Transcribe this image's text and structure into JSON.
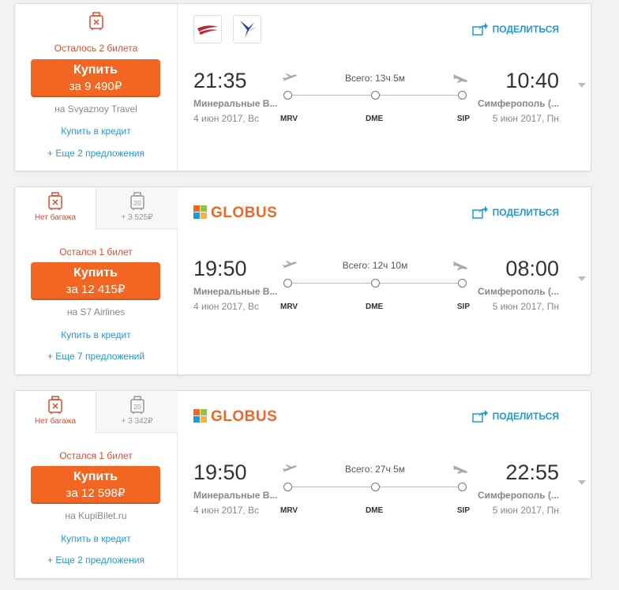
{
  "share_label": "ПОДЕЛИТЬСЯ",
  "buy_label": "Купить",
  "credit_label": "Купить в кредит",
  "cards": [
    {
      "tickets_left": "Осталось 2 билета",
      "price": "за 9 490₽",
      "vendor": "на Svyaznoy Travel",
      "more": "+ Еще 2 предложения",
      "dep_time": "21:35",
      "arr_time": "10:40",
      "dep_city": "Минеральные В...",
      "arr_city": "Симферополь (...",
      "dep_date": "4 июн 2017, Вс",
      "arr_date": "5 июн 2017, Пн",
      "total": "Всего: 13ч 5м",
      "codes": [
        "MRV",
        "DME",
        "SIP"
      ]
    },
    {
      "bag_none": "Нет багажа",
      "bag_extra": "+ 3 525₽",
      "bag_weight": "20",
      "airline": "GLOBUS",
      "tickets_left": "Остался 1 билет",
      "price": "за 12 415₽",
      "vendor": "на S7 Airlines",
      "more": "+ Еще 7 предложений",
      "dep_time": "19:50",
      "arr_time": "08:00",
      "dep_city": "Минеральные В...",
      "arr_city": "Симферополь (...",
      "dep_date": "4 июн 2017, Вс",
      "arr_date": "5 июн 2017, Пн",
      "total": "Всего: 12ч 10м",
      "codes": [
        "MRV",
        "DME",
        "SIP"
      ]
    },
    {
      "bag_none": "Нет багажа",
      "bag_extra": "+ 3 342₽",
      "bag_weight": "20",
      "airline": "GLOBUS",
      "tickets_left": "Остался 1 билет",
      "price": "за 12 598₽",
      "vendor": "на KupiBilet.ru",
      "more": "+ Еще 2 предложения",
      "dep_time": "19:50",
      "arr_time": "22:55",
      "dep_city": "Минеральные В...",
      "arr_city": "Симферополь (...",
      "dep_date": "4 июн 2017, Вс",
      "arr_date": "5 июн 2017, Пн",
      "total": "Всего: 27ч 5м",
      "codes": [
        "MRV",
        "DME",
        "SIP"
      ]
    }
  ]
}
